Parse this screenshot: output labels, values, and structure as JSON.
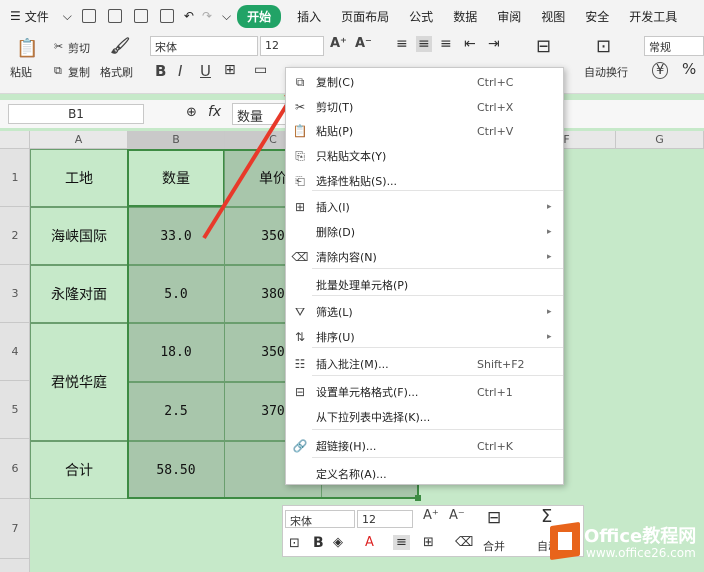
{
  "menubar": {
    "file": "文件",
    "start": "开始",
    "insert": "插入",
    "layout": "页面布局",
    "formula": "公式",
    "data": "数据",
    "review": "审阅",
    "view": "视图",
    "security": "安全",
    "dev": "开发工具"
  },
  "ribbon": {
    "paste": "粘贴",
    "cut": "剪切",
    "copy": "复制",
    "format_painter": "格式刷",
    "font": "宋体",
    "size": "12",
    "wrap": "自动换行",
    "num_format": "常规",
    "currency": "¥",
    "percent": "%",
    "bold": "B",
    "italic": "I",
    "underline": "U",
    "grow": "A⁺",
    "shrink": "A⁻"
  },
  "formulabar": {
    "cell_ref": "B1",
    "fx": "fx",
    "content": "数量"
  },
  "columns": [
    "A",
    "B",
    "C",
    "D",
    "E",
    "F",
    "G"
  ],
  "rows": [
    "1",
    "2",
    "3",
    "4",
    "5",
    "6",
    "7"
  ],
  "table": {
    "r1": [
      "工地",
      "数量",
      "单价"
    ],
    "r2": [
      "海峡国际",
      "33.0",
      "350"
    ],
    "r3": [
      "永隆对面",
      "5.0",
      "380"
    ],
    "r4": [
      "君悦华庭",
      "18.0",
      "350"
    ],
    "r5": [
      "2.5",
      "370"
    ],
    "r6": [
      "合计",
      "58.50"
    ]
  },
  "context_menu": [
    {
      "label": "复制(C)",
      "shortcut": "Ctrl+C",
      "icon": "copy-icon"
    },
    {
      "label": "剪切(T)",
      "shortcut": "Ctrl+X",
      "icon": "cut-icon"
    },
    {
      "label": "粘贴(P)",
      "shortcut": "Ctrl+V",
      "icon": "paste-icon"
    },
    {
      "label": "只粘贴文本(Y)",
      "shortcut": "",
      "icon": "paste-text-icon"
    },
    {
      "label": "选择性粘贴(S)...",
      "shortcut": "",
      "icon": "paste-special-icon"
    },
    {
      "label": "插入(I)",
      "shortcut": "",
      "icon": "insert-icon",
      "sub": true
    },
    {
      "label": "删除(D)",
      "shortcut": "",
      "icon": "",
      "sub": true
    },
    {
      "label": "清除内容(N)",
      "shortcut": "",
      "icon": "eraser-icon",
      "sub": true
    },
    {
      "label": "批量处理单元格(P)",
      "shortcut": "",
      "icon": ""
    },
    {
      "label": "筛选(L)",
      "shortcut": "",
      "icon": "filter-icon",
      "sub": true
    },
    {
      "label": "排序(U)",
      "shortcut": "",
      "icon": "sort-icon",
      "sub": true
    },
    {
      "label": "插入批注(M)...",
      "shortcut": "Shift+F2",
      "icon": "comment-icon"
    },
    {
      "label": "设置单元格格式(F)...",
      "shortcut": "Ctrl+1",
      "icon": "format-cells-icon"
    },
    {
      "label": "从下拉列表中选择(K)...",
      "shortcut": "",
      "icon": ""
    },
    {
      "label": "超链接(H)...",
      "shortcut": "Ctrl+K",
      "icon": "link-icon"
    },
    {
      "label": "定义名称(A)...",
      "shortcut": "",
      "icon": ""
    }
  ],
  "mini_toolbar": {
    "font": "宋体",
    "size": "12",
    "merge": "合并",
    "auto_sum": "自动"
  },
  "watermark": {
    "line1": "Office教程网",
    "line2": "www.office26.com"
  },
  "colors": {
    "accent": "#21a366",
    "grid_bg": "#c6e9c9",
    "selected_bg": "#a8c6ab",
    "arrow": "#e8392a",
    "watermark": "#e8641b"
  }
}
